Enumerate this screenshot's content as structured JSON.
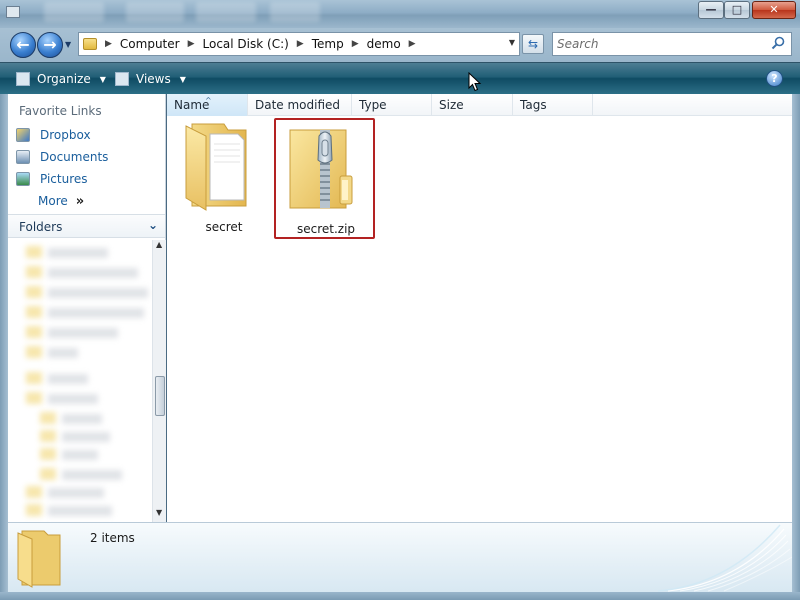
{
  "window": {
    "minimize_glyph": "—",
    "maximize_glyph": "□",
    "close_glyph": "✕"
  },
  "address": {
    "crumbs": [
      "Computer",
      "Local Disk (C:)",
      "Temp",
      "demo"
    ],
    "separator_glyph": "▶"
  },
  "search": {
    "placeholder": "Search"
  },
  "toolbar": {
    "organize_label": "Organize",
    "views_label": "Views",
    "help_glyph": "?"
  },
  "nav": {
    "favorites_title": "Favorite Links",
    "favorites": [
      {
        "label": "Dropbox",
        "icon": "dropbox-icon"
      },
      {
        "label": "Documents",
        "icon": "documents-icon"
      },
      {
        "label": "Pictures",
        "icon": "pictures-icon"
      }
    ],
    "more_label": "More",
    "more_chevron": "»",
    "folders_title": "Folders"
  },
  "columns": {
    "name": "Name",
    "date_modified": "Date modified",
    "type": "Type",
    "size": "Size",
    "tags": "Tags"
  },
  "items": [
    {
      "label": "secret",
      "icon": "folder-icon"
    },
    {
      "label": "secret.zip",
      "icon": "zip-folder-icon"
    }
  ],
  "details": {
    "count_text": "2 items"
  },
  "colors": {
    "selection_border": "#b32222",
    "link_blue": "#1a5e9c",
    "folder_yellow": "#f2d77a"
  }
}
